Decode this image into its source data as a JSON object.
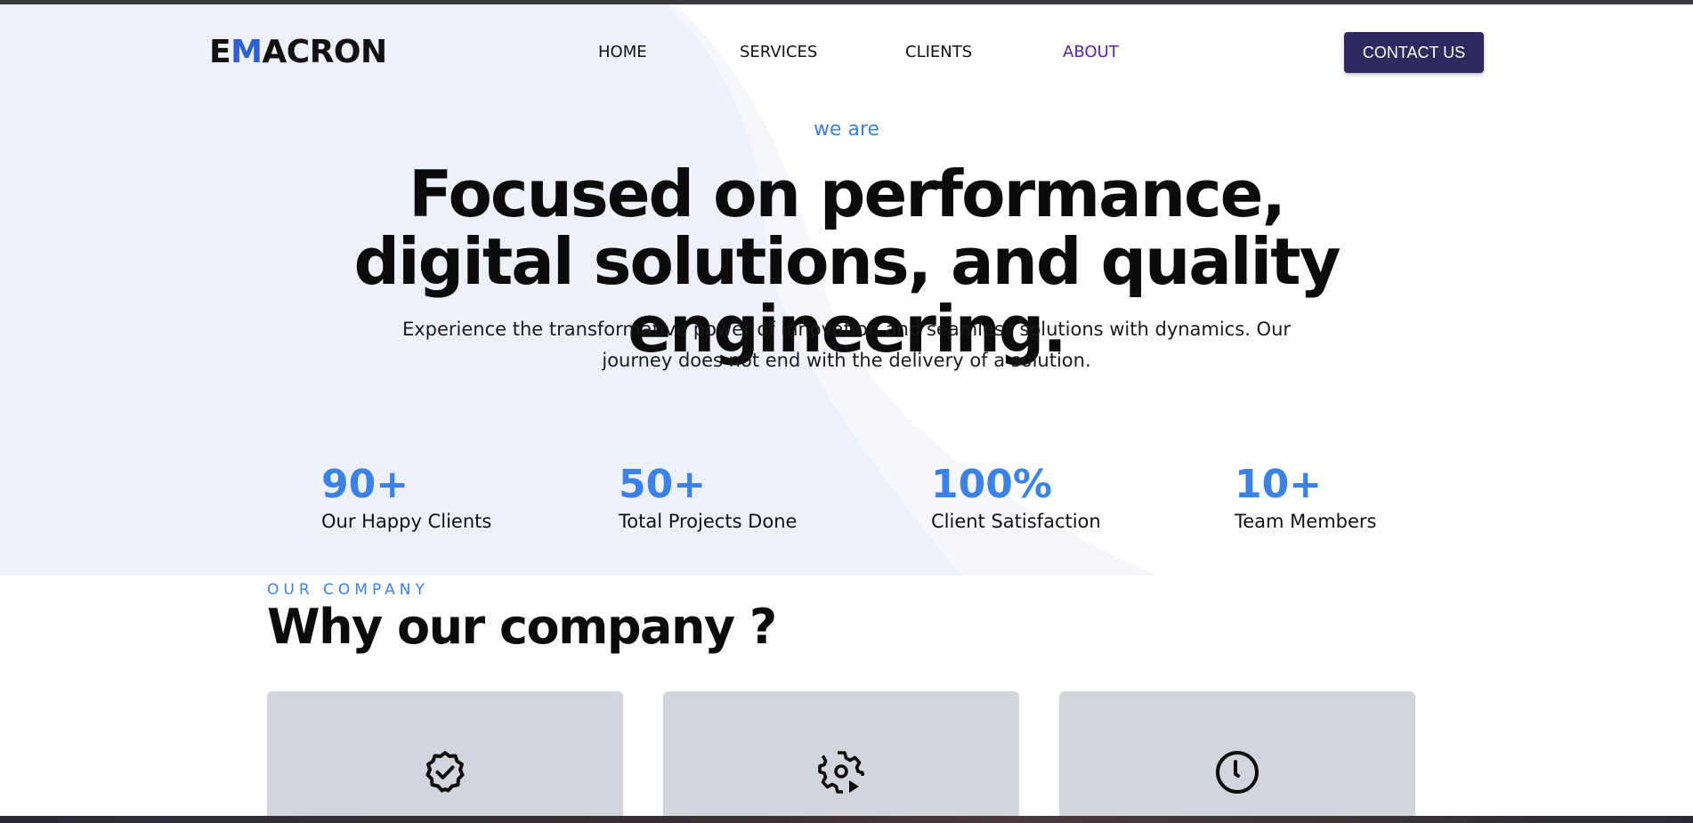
{
  "header": {
    "logo": {
      "prefix": "E",
      "accent": "M",
      "rest": "ACRON"
    },
    "nav": [
      {
        "label": "HOME"
      },
      {
        "label": "SERVICES"
      },
      {
        "label": "CLIENTS"
      },
      {
        "label": "ABOUT",
        "active": true
      }
    ],
    "contact_label": "CONTACT US"
  },
  "hero": {
    "eyebrow": "we are",
    "headline": "Focused on performance, digital solutions, and quality engineering.",
    "subtext": "Experience the transformative power of innovation and seamless solutions with dynamics. Our journey does not end with the delivery of a solution."
  },
  "stats": [
    {
      "value": "90+",
      "label": "Our Happy Clients"
    },
    {
      "value": "50+",
      "label": "Total Projects Done"
    },
    {
      "value": "100%",
      "label": "Client Satisfaction"
    },
    {
      "value": "10+",
      "label": "Team Members"
    }
  ],
  "company": {
    "eyebrow": "OUR COMPANY",
    "title": "Why our company ?",
    "cards": [
      {
        "icon": "verified-badge-icon"
      },
      {
        "icon": "gear-play-icon"
      },
      {
        "icon": "clock-icon"
      }
    ]
  },
  "colors": {
    "accent_blue": "#3b82e8",
    "logo_accent": "#2f5fd6",
    "active_nav": "#5b21b6",
    "button_bg": "#2e2a5f",
    "hero_bg": "#eff2fb",
    "card_bg": "#d2d5db"
  }
}
